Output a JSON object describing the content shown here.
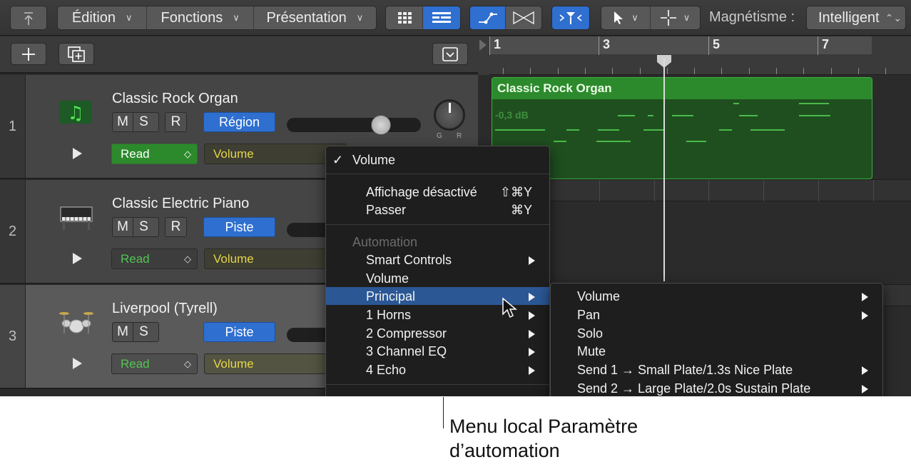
{
  "controlbar": {
    "edition": "Édition",
    "fonctions": "Fonctions",
    "presentation": "Présentation",
    "magnetisme_label": "Magnétisme :",
    "magnetisme_value": "Intelligent"
  },
  "tracks": [
    {
      "number": "1",
      "name": "Classic Rock Organ",
      "m": "M",
      "s": "S",
      "r": "R",
      "mode_button": "Région",
      "automation_mode": "Read",
      "parameter": "Volume",
      "icon": "organ-icon"
    },
    {
      "number": "2",
      "name": "Classic Electric Piano",
      "m": "M",
      "s": "S",
      "r": "R",
      "mode_button": "Piste",
      "automation_mode": "Read",
      "parameter": "Volume",
      "icon": "electric-piano-icon"
    },
    {
      "number": "3",
      "name": "Liverpool (Tyrell)",
      "m": "M",
      "s": "S",
      "mode_button": "Piste",
      "automation_mode": "Read",
      "parameter": "Volume",
      "icon": "drum-kit-icon"
    }
  ],
  "pan_labels": {
    "left": "G",
    "right": "R"
  },
  "ruler": {
    "bars": [
      "1",
      "3",
      "5",
      "7"
    ]
  },
  "region": {
    "name": "Classic Rock Organ",
    "value": "-0,3 dB"
  },
  "menu": {
    "checked_item": "Volume",
    "display_off": "Affichage désactivé",
    "display_off_shortcut": "⇧⌘Y",
    "skip": "Passer",
    "skip_shortcut": "⌘Y",
    "section_header": "Automation",
    "items": [
      "Smart Controls",
      "Volume",
      "Principal",
      "1 Horns",
      "2 Compressor",
      "3 Channel EQ",
      "4 Echo"
    ]
  },
  "submenu": {
    "items": [
      "Volume",
      "Pan",
      "Solo",
      "Mute",
      "Send 1 → Small Plate/1.3s Nice Plate",
      "Send 2 → Large Plate/2.0s Sustain Plate"
    ]
  },
  "callout": {
    "line1": "Menu local Paramètre",
    "line2": "d’automation"
  },
  "colors": {
    "accent_blue": "#2e6fd0",
    "read_green": "#2c8a2c",
    "region_green": "#2c8a2c",
    "param_yellow": "#e6d646",
    "menu_highlight": "#2b5795"
  }
}
